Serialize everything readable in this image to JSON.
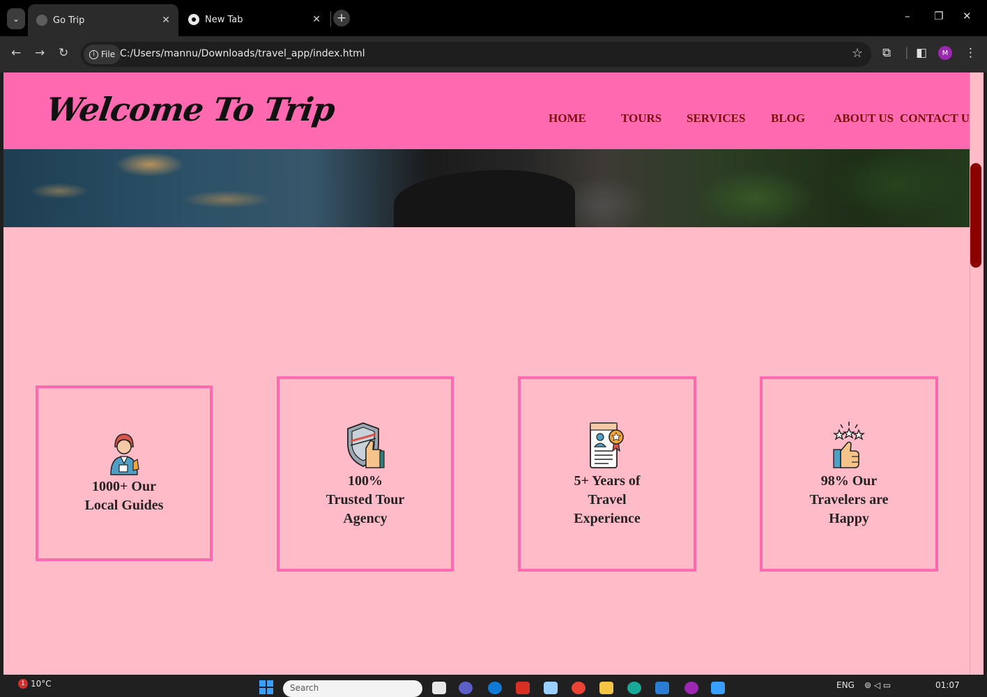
{
  "browser": {
    "tabs": [
      {
        "title": "Go Trip",
        "active": true
      },
      {
        "title": "New Tab",
        "active": false
      }
    ],
    "address": {
      "chip": "File",
      "url": "C:/Users/mannu/Downloads/travel_app/index.html"
    },
    "profile_initial": "M"
  },
  "site": {
    "logo": "Welcome To Trip",
    "nav": [
      "HOME",
      "TOURS",
      "SERVICES",
      "BLOG",
      "ABOUT US",
      "CONTACT US"
    ]
  },
  "stats": [
    {
      "icon": "local-guide-icon",
      "lines": [
        "1000+ Our",
        "Local Guides"
      ]
    },
    {
      "icon": "trusted-shield-icon",
      "lines": [
        "100%",
        "Trusted Tour",
        "Agency"
      ]
    },
    {
      "icon": "certificate-icon",
      "lines": [
        "5+ Years of",
        "Travel",
        "Experience"
      ]
    },
    {
      "icon": "happy-rating-icon",
      "lines": [
        "98% Our",
        "Travelers are",
        "Happy"
      ]
    }
  ],
  "colors": {
    "header": "#ff69b0",
    "page": "#ffbcc8",
    "nav_text": "#7a0e0e",
    "scroll_thumb": "#8b0000"
  },
  "taskbar": {
    "weather_badge": "1",
    "temperature": "10°C",
    "search_placeholder": "Search",
    "language": "ENG",
    "time": "01:07"
  }
}
